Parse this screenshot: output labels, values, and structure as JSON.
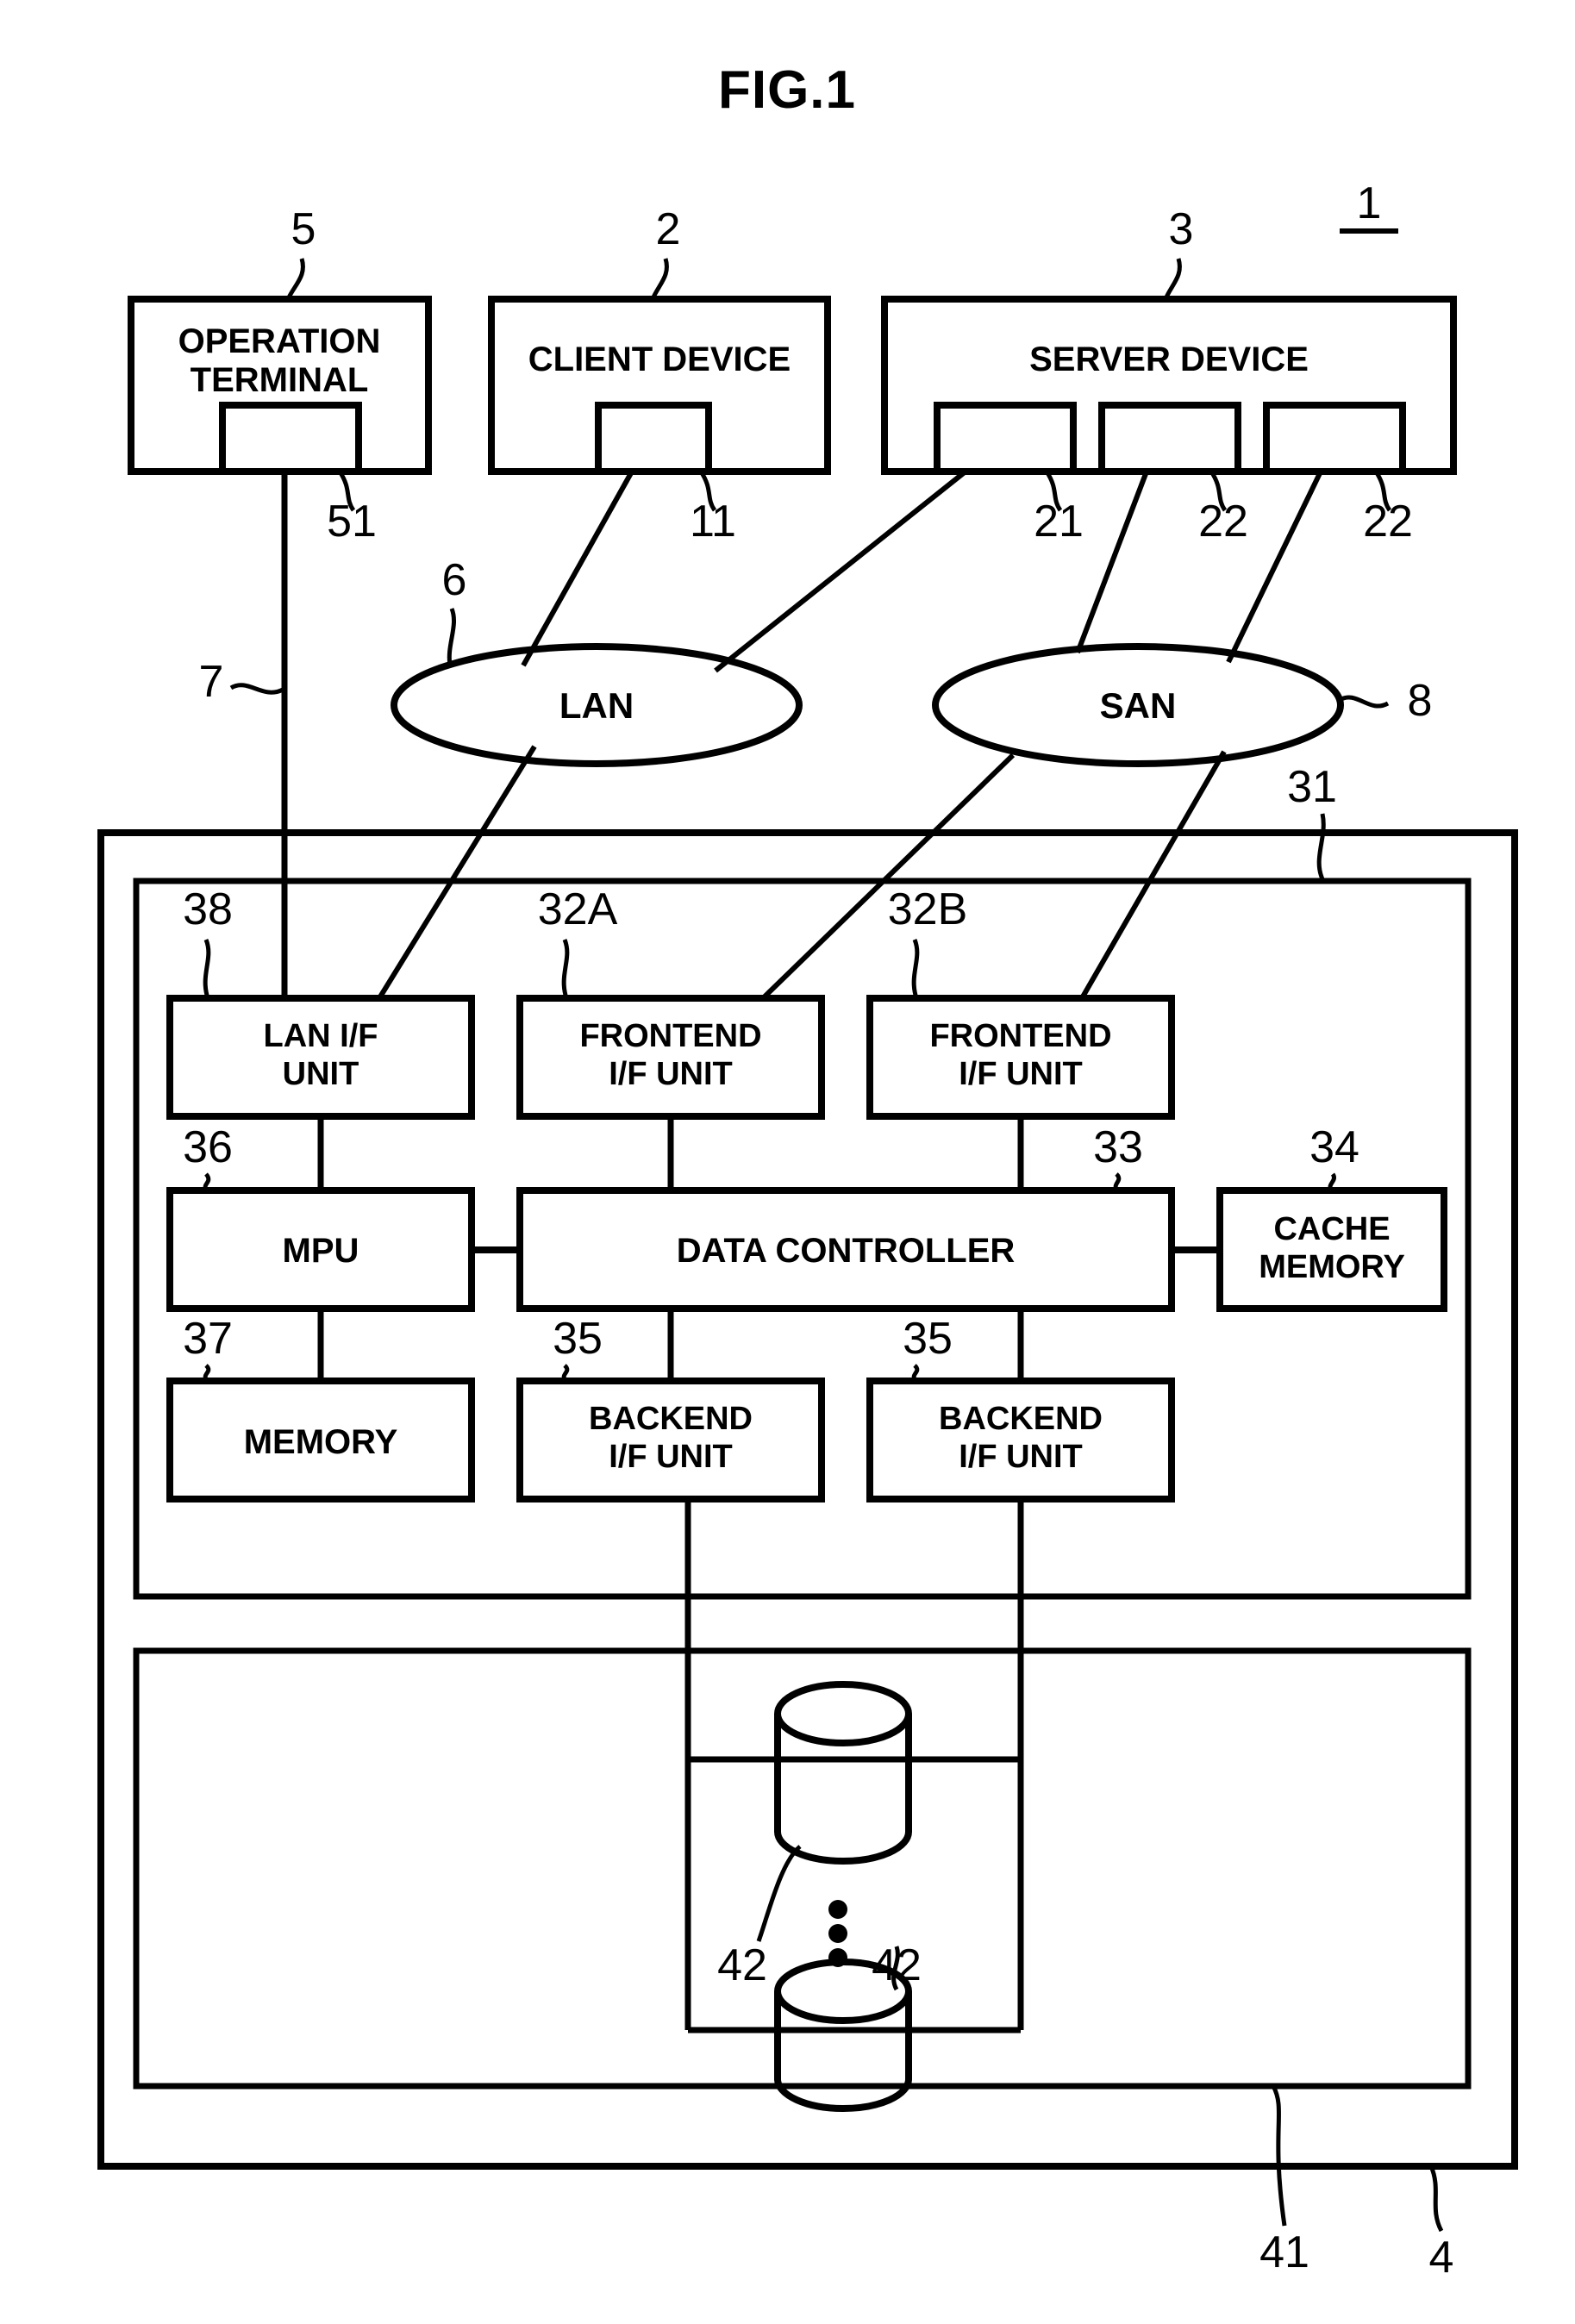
{
  "figure": {
    "title": "FIG.1",
    "system_ref": "1"
  },
  "top_devices": [
    {
      "label_line1": "OPERATION",
      "label_line2": "TERMINAL",
      "ref": "5",
      "port_refs": [
        "51"
      ]
    },
    {
      "label_line1": "CLIENT DEVICE",
      "label_line2": "",
      "ref": "2",
      "port_refs": [
        "11"
      ]
    },
    {
      "label_line1": "SERVER DEVICE",
      "label_line2": "",
      "ref": "3",
      "port_refs": [
        "21",
        "22",
        "22"
      ]
    }
  ],
  "networks": [
    {
      "label": "LAN",
      "ref": "6"
    },
    {
      "label": "SAN",
      "ref": "8"
    }
  ],
  "management_link_ref": "7",
  "storage_system": {
    "ref": "4",
    "controller": {
      "ref": "31",
      "units": [
        {
          "label_line1": "LAN I/F",
          "label_line2": "UNIT",
          "ref": "38"
        },
        {
          "label_line1": "FRONTEND",
          "label_line2": "I/F UNIT",
          "ref": "32A"
        },
        {
          "label_line1": "FRONTEND",
          "label_line2": "I/F UNIT",
          "ref": "32B"
        },
        {
          "label_line1": "MPU",
          "label_line2": "",
          "ref": "36"
        },
        {
          "label_line1": "DATA CONTROLLER",
          "label_line2": "",
          "ref": "33"
        },
        {
          "label_line1": "CACHE",
          "label_line2": "MEMORY",
          "ref": "34"
        },
        {
          "label_line1": "MEMORY",
          "label_line2": "",
          "ref": "37"
        },
        {
          "label_line1": "BACKEND",
          "label_line2": "I/F UNIT",
          "ref": "35"
        },
        {
          "label_line1": "BACKEND",
          "label_line2": "I/F UNIT",
          "ref": "35"
        }
      ]
    },
    "drive_enclosure": {
      "ref": "41",
      "drives": [
        {
          "ref": "42"
        },
        {
          "ref": "42"
        }
      ],
      "continuation_symbol": "vertical-ellipsis"
    }
  },
  "colors": {
    "stroke": "#000000",
    "background": "#ffffff"
  }
}
